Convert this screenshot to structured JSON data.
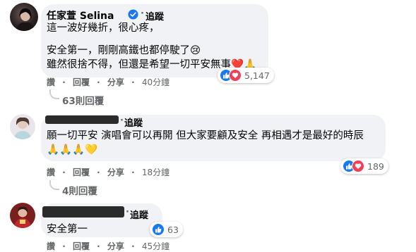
{
  "comments": [
    {
      "author": "任家萱 Selina",
      "follow_label": "追蹤",
      "lines": [
        "這一波好幾折，很心疼，",
        "",
        "安全第一，剛剛高鐵也都停駛了😢",
        "雖然很捨不得，但還是希望一切平安無事❤️🙏"
      ],
      "actions": {
        "like": "讚",
        "reply": "回覆",
        "share": "分享",
        "time": "40分鐘"
      },
      "reaction_count": "5,147",
      "replies_label": "63則回覆"
    },
    {
      "follow_label": "追蹤",
      "lines": [
        "願一切平安 演唱會可以再開 但大家要顧及安全 再相遇才是最好的時辰",
        "🙏🙏🙏💛"
      ],
      "actions": {
        "like": "讚",
        "reply": "回覆",
        "share": "分享",
        "time": "18分鐘"
      },
      "reaction_count": "189",
      "replies_label": "4則回覆"
    },
    {
      "follow_label": "追蹤",
      "lines": [
        "安全第一"
      ],
      "actions": {
        "like": "讚",
        "reply": "回覆",
        "share": "分享",
        "time": "45分鐘"
      },
      "reaction_count": "63"
    }
  ],
  "colors": {
    "bubble": "#f0f2f5",
    "like_blue": "#1877f2",
    "love_red": "#f33e58",
    "verified_blue": "#1877f2",
    "meta_gray": "#65676b"
  }
}
